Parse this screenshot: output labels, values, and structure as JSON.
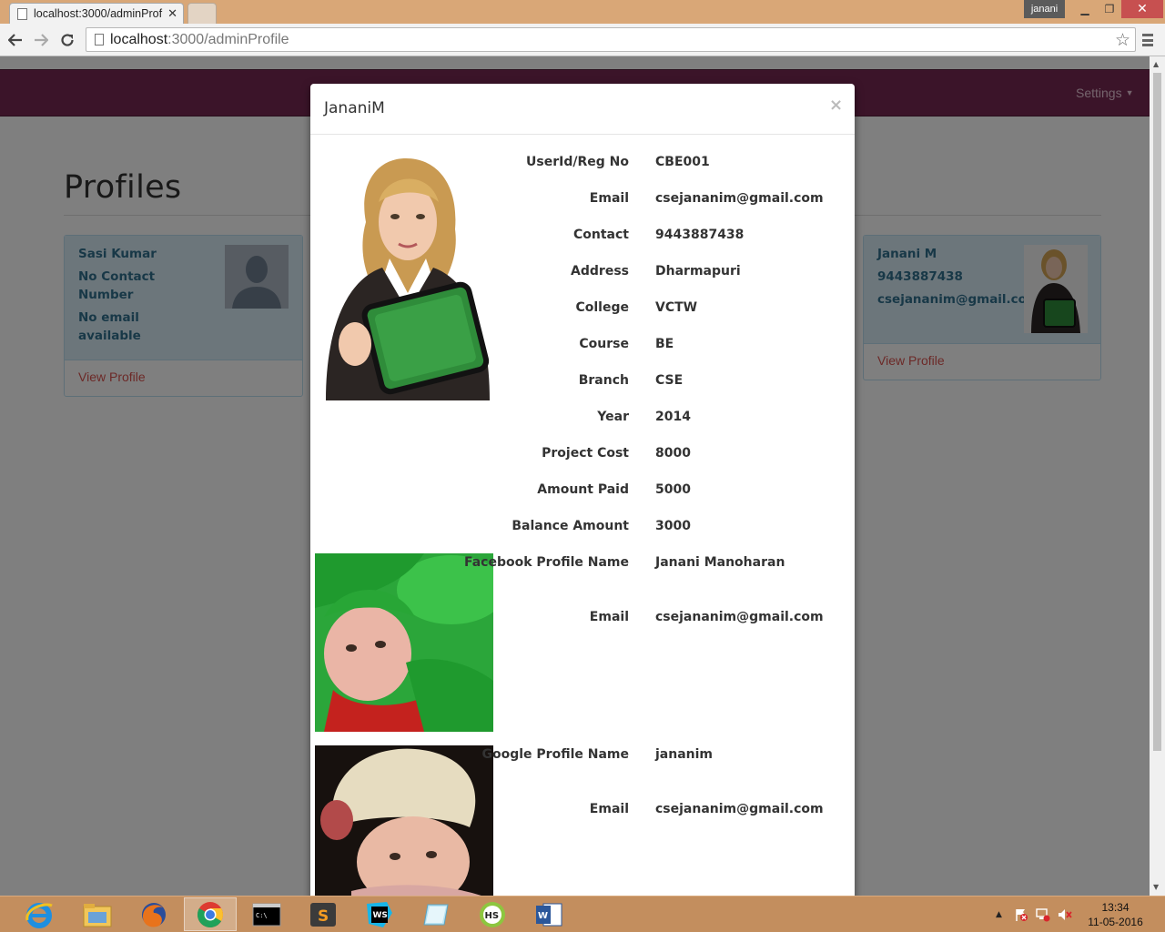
{
  "browser": {
    "tab_title": "localhost:3000/adminProf",
    "url_host": "localhost",
    "url_path": ":3000/adminProfile",
    "user_name": "janani"
  },
  "navbar": {
    "settings_label": "Settings"
  },
  "page": {
    "title": "Profiles"
  },
  "cards": [
    {
      "lines": [
        "Sasi Kumar",
        "No Contact Number",
        "No email available"
      ],
      "link": "View Profile"
    },
    {
      "lines": [
        "Janani M",
        "9443887438",
        "csejananim@gmail.com"
      ],
      "link": "View Profile"
    }
  ],
  "modal": {
    "title": "JananiM",
    "close": "×",
    "fields": [
      {
        "label": "UserId/Reg No",
        "value": "CBE001"
      },
      {
        "label": "Email",
        "value": "csejananim@gmail.com"
      },
      {
        "label": "Contact",
        "value": "9443887438"
      },
      {
        "label": "Address",
        "value": "Dharmapuri"
      },
      {
        "label": "College",
        "value": "VCTW"
      },
      {
        "label": "Course",
        "value": "BE"
      },
      {
        "label": "Branch",
        "value": "CSE"
      },
      {
        "label": "Year",
        "value": "2014"
      },
      {
        "label": "Project Cost",
        "value": "8000"
      },
      {
        "label": "Amount Paid",
        "value": "5000"
      },
      {
        "label": "Balance Amount",
        "value": "3000"
      }
    ],
    "facebook": {
      "name_label": "Facebook Profile Name",
      "name_value": "Janani Manoharan",
      "email_label": "Email",
      "email_value": "csejananim@gmail.com"
    },
    "google": {
      "name_label": "Google Profile Name",
      "name_value": "jananim",
      "email_label": "Email",
      "email_value": "csejananim@gmail.com"
    }
  },
  "taskbar": {
    "apps": [
      "internet-explorer",
      "file-explorer",
      "firefox",
      "chrome",
      "command-prompt",
      "sublime-text",
      "webstorm",
      "notes",
      "hs-app",
      "word"
    ],
    "time": "13:34",
    "date": "11-05-2016"
  },
  "colors": {
    "navbar": "#772953",
    "card_bg": "#d9edf7",
    "card_text": "#31708f",
    "link": "#d9534f"
  }
}
